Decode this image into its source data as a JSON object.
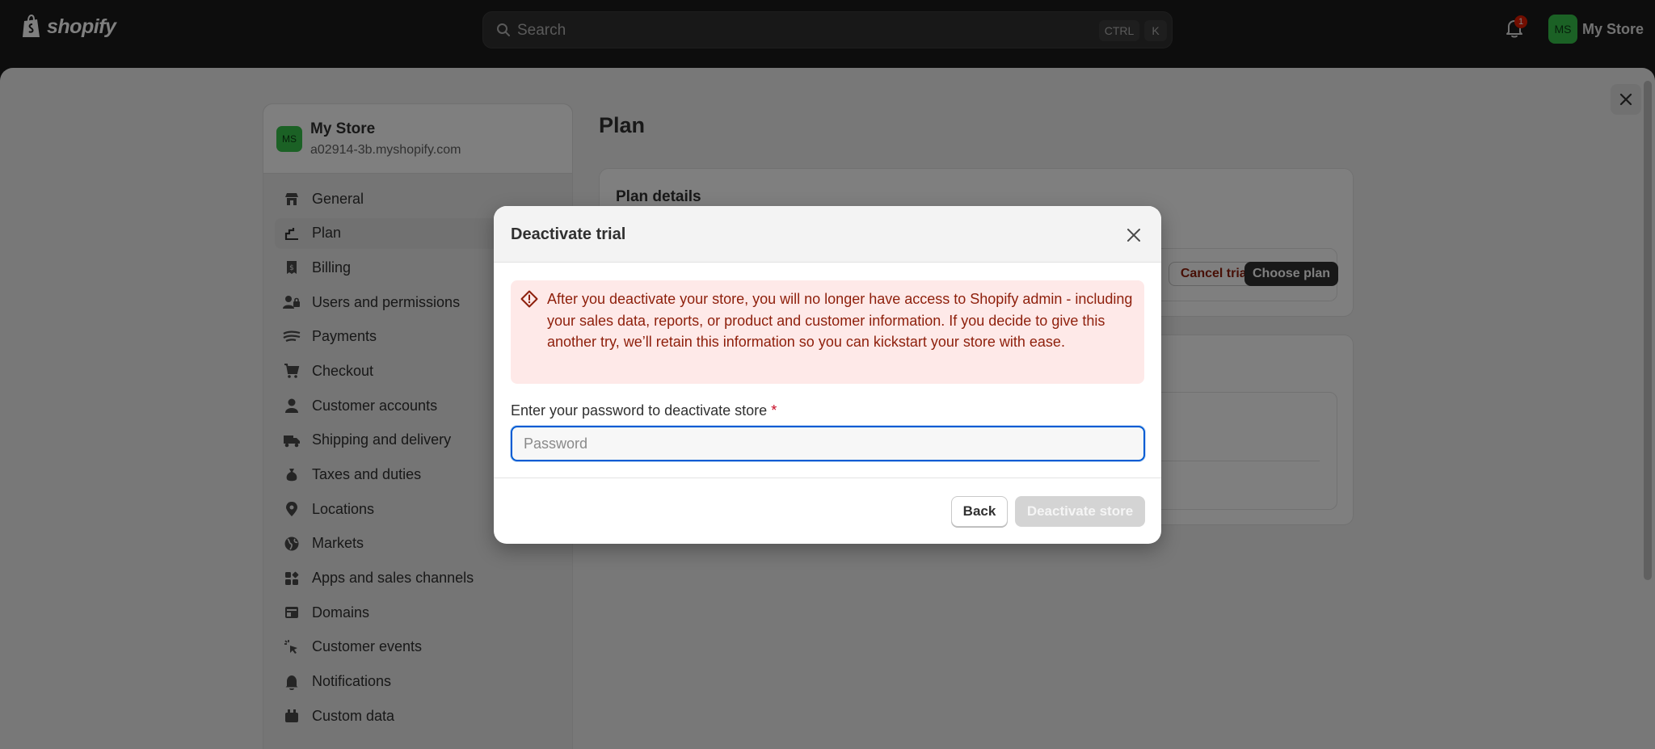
{
  "topbar": {
    "logo_text": "shopify",
    "search_placeholder": "Search",
    "shortcut_ctrl": "CTRL",
    "shortcut_k": "K",
    "notification_count": "1",
    "avatar_initials": "MS",
    "store_name": "My Store"
  },
  "sidebar": {
    "store_initials": "MS",
    "store_name": "My Store",
    "store_domain": "a02914-3b.myshopify.com",
    "items": [
      {
        "label": "General",
        "icon": "store-icon"
      },
      {
        "label": "Plan",
        "icon": "plan-icon",
        "active": true
      },
      {
        "label": "Billing",
        "icon": "receipt-icon"
      },
      {
        "label": "Users and permissions",
        "icon": "users-icon"
      },
      {
        "label": "Payments",
        "icon": "payments-icon"
      },
      {
        "label": "Checkout",
        "icon": "cart-icon"
      },
      {
        "label": "Customer accounts",
        "icon": "person-icon"
      },
      {
        "label": "Shipping and delivery",
        "icon": "truck-icon"
      },
      {
        "label": "Taxes and duties",
        "icon": "tax-icon"
      },
      {
        "label": "Locations",
        "icon": "location-icon"
      },
      {
        "label": "Markets",
        "icon": "globe-icon"
      },
      {
        "label": "Apps and sales channels",
        "icon": "apps-icon"
      },
      {
        "label": "Domains",
        "icon": "domain-icon"
      },
      {
        "label": "Customer events",
        "icon": "cursor-icon"
      },
      {
        "label": "Notifications",
        "icon": "bell-icon"
      },
      {
        "label": "Custom data",
        "icon": "database-icon"
      }
    ]
  },
  "main": {
    "title": "Plan",
    "plan_details_title": "Plan details",
    "cancel_trial_label": "Cancel trial",
    "choose_plan_label": "Choose plan"
  },
  "modal": {
    "title": "Deactivate trial",
    "warning_text": "After you deactivate your store, you will no longer have access to Shopify admin - including your sales data, reports, or product and customer information. If you decide to give this another try, we’ll retain this information so you can kickstart your store with ease.",
    "password_label": "Enter your password to deactivate store",
    "required_mark": "*",
    "password_placeholder": "Password",
    "back_label": "Back",
    "deactivate_label": "Deactivate store"
  },
  "colors": {
    "topbar_bg": "#1a1a1a",
    "avatar_green": "#36c24b",
    "critical_bg": "#fee9e8",
    "critical_text": "#8e1f0b",
    "focus_blue": "#005bd3"
  }
}
